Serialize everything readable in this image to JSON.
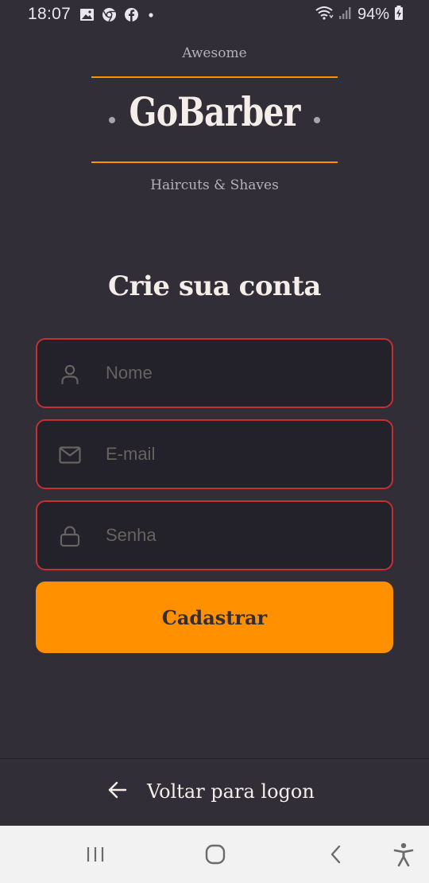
{
  "status_bar": {
    "time": "18:07",
    "battery": "94%",
    "icons": [
      "image-icon",
      "chrome-icon",
      "facebook-icon",
      "notification-dot-icon",
      "wifi-icon",
      "signal-icon",
      "battery-charging-icon"
    ]
  },
  "logo": {
    "top_text": "Awesome",
    "main_text": "GoBarber",
    "bottom_text": "Haircuts & Shaves",
    "accent_color": "#ff9000"
  },
  "page": {
    "title": "Crie sua conta"
  },
  "form": {
    "name": {
      "placeholder": "Nome",
      "value": "",
      "icon": "user-icon"
    },
    "email": {
      "placeholder": "E-mail",
      "value": "",
      "icon": "mail-icon"
    },
    "password": {
      "placeholder": "Senha",
      "value": "",
      "icon": "lock-icon"
    },
    "submit_label": "Cadastrar",
    "error_border_color": "#c53030"
  },
  "footer": {
    "back_label": "Voltar para logon",
    "icon": "arrow-left-icon"
  },
  "nav_bar": {
    "buttons": [
      "recent-apps-icon",
      "home-icon",
      "back-icon",
      "accessibility-icon"
    ]
  },
  "colors": {
    "background": "#312e38",
    "input_background": "#232129",
    "button": "#ff9000",
    "text": "#f4ede8",
    "placeholder": "#666360"
  }
}
